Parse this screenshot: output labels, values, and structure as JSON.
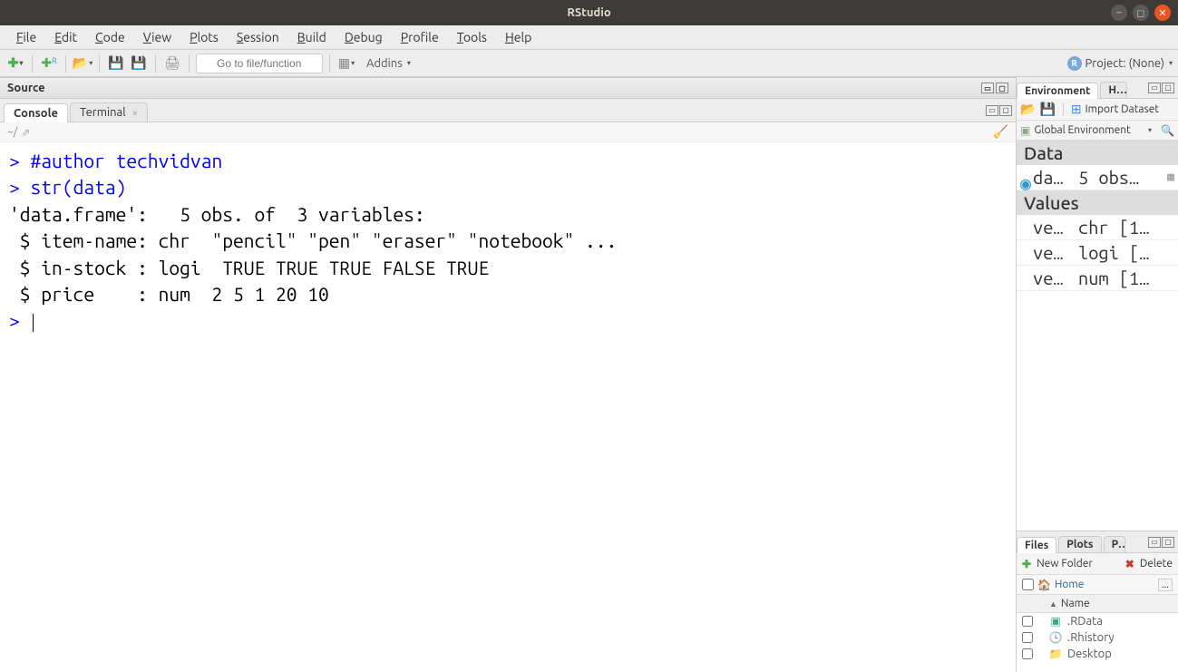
{
  "window": {
    "title": "RStudio"
  },
  "menu": {
    "file": "File",
    "edit": "Edit",
    "code": "Code",
    "view": "View",
    "plots": "Plots",
    "session": "Session",
    "build": "Build",
    "debug": "Debug",
    "profile": "Profile",
    "tools": "Tools",
    "help": "Help"
  },
  "toolbar": {
    "goto_placeholder": "Go to file/function",
    "addins_label": "Addins",
    "project_label": "Project: (None)"
  },
  "source": {
    "header": "Source"
  },
  "console": {
    "tab_console": "Console",
    "tab_terminal": "Terminal",
    "breadcrumb": "~/",
    "lines": [
      {
        "type": "code",
        "prompt": "> ",
        "text": "#author techvidvan",
        "cls": "comment"
      },
      {
        "type": "code",
        "prompt": "> ",
        "text": "str(data)",
        "cls": "code-call"
      },
      {
        "type": "out",
        "text": "'data.frame':   5 obs. of  3 variables:"
      },
      {
        "type": "out",
        "text": " $ item-name: chr  \"pencil\" \"pen\" \"eraser\" \"notebook\" ..."
      },
      {
        "type": "out",
        "text": " $ in-stock : logi  TRUE TRUE TRUE FALSE TRUE"
      },
      {
        "type": "out",
        "text": " $ price    : num  2 5 1 20 10"
      },
      {
        "type": "prompt",
        "prompt": "> ",
        "text": ""
      }
    ]
  },
  "environment": {
    "tab_env": "Environment",
    "tab_history": "His",
    "import_label": "Import Dataset",
    "scope_label": "Global Environment",
    "data_section": "Data",
    "values_section": "Values",
    "rows": [
      {
        "section": "data",
        "name": "da…",
        "value": "5 obs…",
        "has_blue": true,
        "has_grid": true
      },
      {
        "section": "values",
        "name": "ve…",
        "value": "chr [1…"
      },
      {
        "section": "values",
        "name": "ve…",
        "value": "logi […"
      },
      {
        "section": "values",
        "name": "ve…",
        "value": "num [1…"
      }
    ]
  },
  "files": {
    "tab_files": "Files",
    "tab_plots": "Plots",
    "tab_packages": "Pa",
    "new_folder": "New Folder",
    "delete": "Delete",
    "breadcrumb_home": "Home",
    "col_name": "Name",
    "ellipsis": "...",
    "items": [
      {
        "icon": "rdata",
        "name": ".RData"
      },
      {
        "icon": "clock",
        "name": ".Rhistory"
      },
      {
        "icon": "folder",
        "name": "Desktop"
      }
    ]
  }
}
